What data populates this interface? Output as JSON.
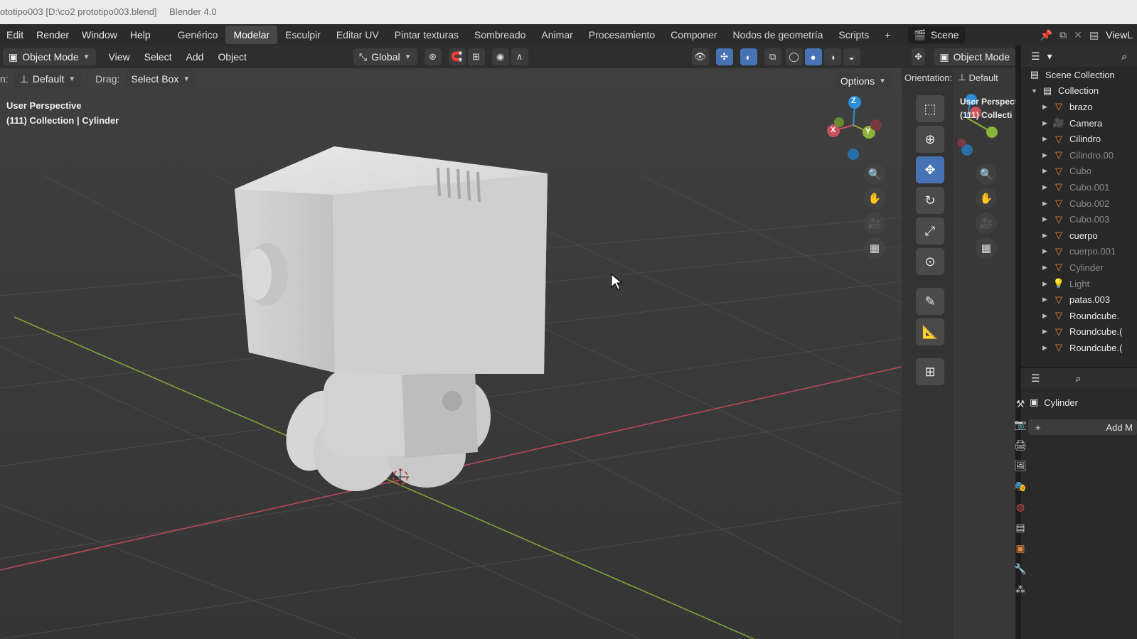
{
  "title_bar": {
    "file": "ototipo003 [D:\\co2 prototipo003.blend]",
    "app": "Blender 4.0"
  },
  "menubar": {
    "menus": [
      "Edit",
      "Render",
      "Window",
      "Help"
    ],
    "workspaces": [
      "Genérico",
      "Modelar",
      "Esculpir",
      "Editar UV",
      "Pintar texturas",
      "Sombreado",
      "Animar",
      "Procesamiento",
      "Componer",
      "Nodos de geometría",
      "Scripts"
    ],
    "active_workspace": "Modelar",
    "add_workspace": "+",
    "scene": "Scene",
    "view_layer": "ViewL"
  },
  "viewport_header": {
    "mode": "Object Mode",
    "menus": [
      "View",
      "Select",
      "Add",
      "Object"
    ],
    "transform_orientation": "Global"
  },
  "tool_settings": {
    "orientation_label": "n:",
    "orientation_value": "Default",
    "drag_label": "Drag:",
    "drag_value": "Select Box",
    "options": "Options"
  },
  "viewport_info": {
    "view": "User Perspective",
    "context": "(111) Collection | Cylinder"
  },
  "gizmo": {
    "x": "X",
    "y": "Y",
    "z": "Z"
  },
  "secondary_view": {
    "mode": "Object Mode",
    "orientation_label": "Orientation:",
    "orientation_value": "Default",
    "view": "User Perspecti",
    "context": "(111) Collecti"
  },
  "outliner": {
    "root": "Scene Collection",
    "collection": "Collection",
    "items": [
      {
        "name": "brazo",
        "type": "mesh",
        "dim": false
      },
      {
        "name": "Camera",
        "type": "camera",
        "dim": false
      },
      {
        "name": "Cilindro",
        "type": "mesh",
        "dim": false
      },
      {
        "name": "Cilindro.00",
        "type": "mesh",
        "dim": true
      },
      {
        "name": "Cubo",
        "type": "mesh",
        "dim": true
      },
      {
        "name": "Cubo.001",
        "type": "mesh",
        "dim": true
      },
      {
        "name": "Cubo.002",
        "type": "mesh",
        "dim": true
      },
      {
        "name": "Cubo.003",
        "type": "mesh",
        "dim": true
      },
      {
        "name": "cuerpo",
        "type": "mesh",
        "dim": false
      },
      {
        "name": "cuerpo.001",
        "type": "mesh",
        "dim": true
      },
      {
        "name": "Cylinder",
        "type": "mesh",
        "dim": true
      },
      {
        "name": "Light",
        "type": "light",
        "dim": true
      },
      {
        "name": "patas.003",
        "type": "mesh",
        "dim": false
      },
      {
        "name": "Roundcube.",
        "type": "mesh",
        "dim": false
      },
      {
        "name": "Roundcube.(",
        "type": "mesh",
        "dim": false
      },
      {
        "name": "Roundcube.(",
        "type": "mesh",
        "dim": false
      }
    ]
  },
  "properties": {
    "object_name": "Cylinder",
    "add_modifier": "Add M"
  },
  "colors": {
    "accent": "#4772b3",
    "x_axis": "#c8505a",
    "y_axis": "#8bb43a",
    "z_axis": "#2c8fd6",
    "mesh_icon": "#e8893a"
  }
}
